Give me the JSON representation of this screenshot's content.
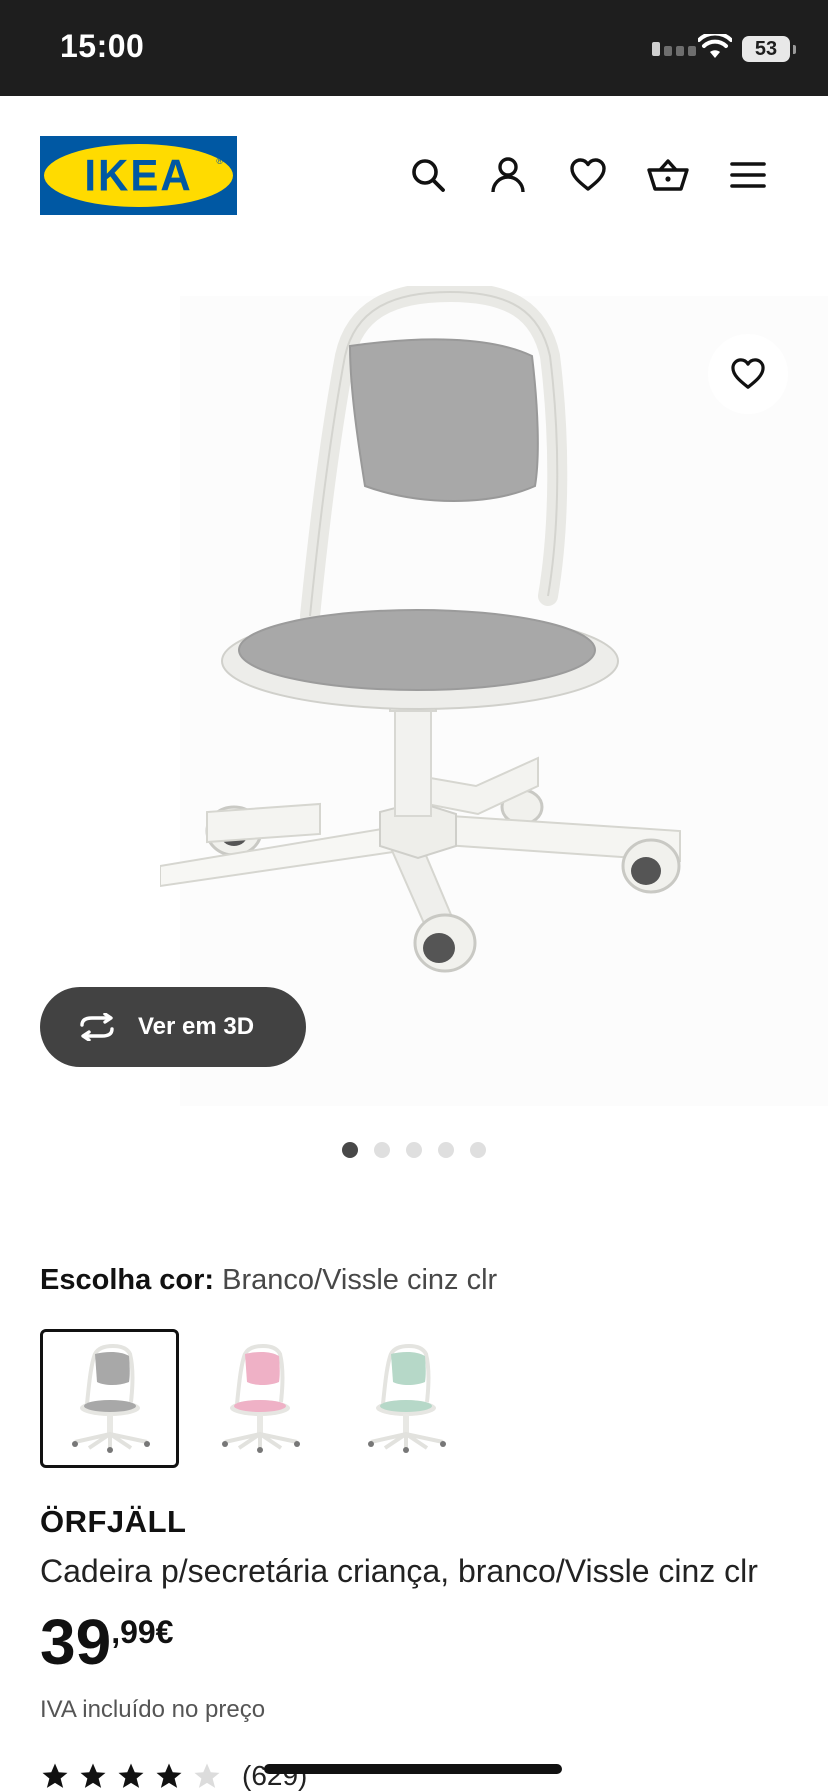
{
  "status_bar": {
    "time": "15:00",
    "battery": "53"
  },
  "header": {
    "logo_text": "IKEA",
    "logo_colors": {
      "background": "#0058a3",
      "oval": "#ffdb00"
    },
    "icons": [
      "search-icon",
      "account-icon",
      "heart-icon",
      "basket-icon",
      "menu-icon"
    ]
  },
  "gallery": {
    "view_3d_label": "Ver em 3D",
    "image_count": 5,
    "active_image": 1,
    "seat_color": "#a8a8a8"
  },
  "product": {
    "color_label": "Escolha cor:",
    "color_value": "Branco/Vissle cinz clr",
    "swatches": [
      {
        "name": "Branco/Vissle cinz clr",
        "seat_color": "#a8a8a8",
        "selected": true
      },
      {
        "name": "pink",
        "seat_color": "#efb1c6",
        "selected": false
      },
      {
        "name": "green",
        "seat_color": "#b6d8c8",
        "selected": false
      }
    ],
    "name": "ÖRFJÄLL",
    "description": "Cadeira p/secretária criança, branco/Vissle cinz clr",
    "price_integer": "39",
    "price_decimal": ",99€",
    "vat_note": "IVA incluído no preço",
    "rating_value": 4,
    "rating_max": 5,
    "rating_count": "(629)"
  },
  "colors": {
    "accent_dark": "#111111",
    "ikea_blue": "#0058a3",
    "ikea_yellow": "#ffdb00"
  }
}
